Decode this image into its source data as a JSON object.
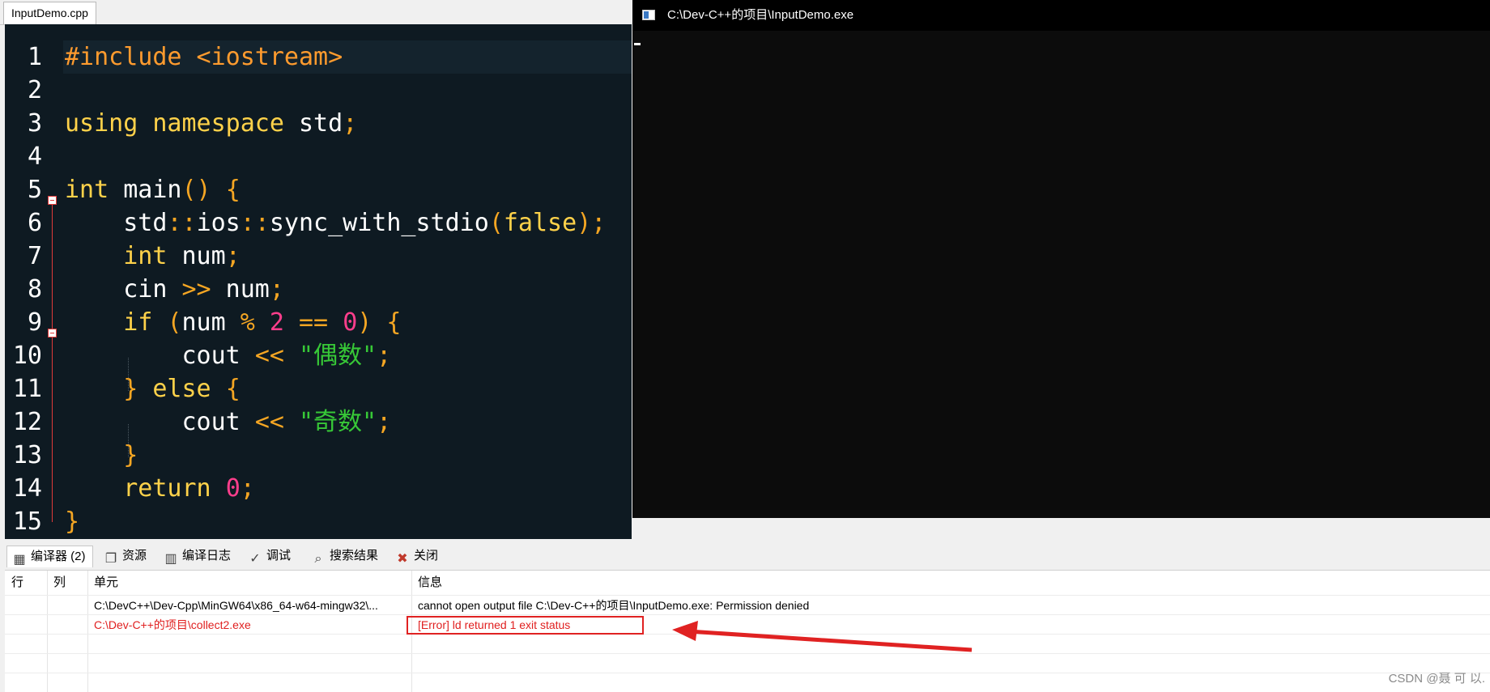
{
  "editor": {
    "tab_label": "InputDemo.cpp",
    "line_numbers": [
      "1",
      "2",
      "3",
      "4",
      "5",
      "6",
      "7",
      "8",
      "9",
      "10",
      "11",
      "12",
      "13",
      "14",
      "15"
    ]
  },
  "console": {
    "title": "C:\\Dev-C++的项目\\InputDemo.exe"
  },
  "bottom_tabs": [
    {
      "label": "编译器 (2)",
      "icon": "grid-icon"
    },
    {
      "label": "资源",
      "icon": "resources-icon"
    },
    {
      "label": "编译日志",
      "icon": "bar-chart-icon"
    },
    {
      "label": "调试",
      "icon": "check-icon"
    },
    {
      "label": "搜索结果",
      "icon": "search-icon"
    },
    {
      "label": "关闭",
      "icon": "close-icon"
    }
  ],
  "messages": {
    "headers": {
      "row": "行",
      "col": "列",
      "unit": "单元",
      "info": "信息"
    },
    "rows": [
      {
        "unit": "C:\\DevC++\\Dev-Cpp\\MinGW64\\x86_64-w64-mingw32\\...",
        "info": "cannot open output file C:\\Dev-C++的项目\\InputDemo.exe: Permission denied",
        "color": "#000000"
      },
      {
        "unit": "C:\\Dev-C++的项目\\collect2.exe",
        "info": "[Error] ld returned 1 exit status",
        "color": "#e02020"
      }
    ]
  },
  "watermark": "CSDN @聂 可 以.",
  "colors": {
    "editor_bg": "#0e1a22",
    "keyword": "#ffd24a",
    "string": "#37c837",
    "number": "#ff3e8c",
    "error": "#e02020",
    "annotation": "#e02222"
  }
}
